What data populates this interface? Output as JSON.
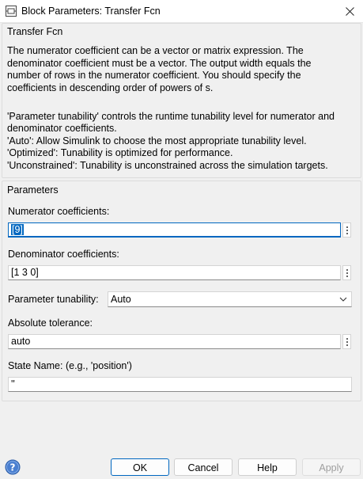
{
  "window": {
    "title": "Block Parameters: Transfer Fcn",
    "app_icon": "simulink-block-icon",
    "close_icon": "close-icon"
  },
  "block_section": {
    "label": "Transfer Fcn",
    "description": [
      "The numerator coefficient can be a vector or matrix expression. The",
      "denominator coefficient must be a vector. The output width equals the",
      "number of rows in the numerator coefficient. You should specify the",
      "coefficients in descending order of powers of s.",
      "",
      "'Parameter tunability' controls the runtime tunability level for numerator and",
      "denominator coefficients.",
      "'Auto': Allow Simulink to choose the most appropriate tunability level.",
      "'Optimized': Tunability is optimized for performance.",
      "'Unconstrained': Tunability is unconstrained across the simulation targets."
    ]
  },
  "parameters": {
    "label": "Parameters",
    "numerator_label": "Numerator coefficients:",
    "numerator_value": "[9]",
    "denominator_label": "Denominator coefficients:",
    "denominator_value": "[1 3 0]",
    "tunability_label": "Parameter tunability:",
    "tunability_value": "Auto",
    "abs_tol_label": "Absolute tolerance:",
    "abs_tol_value": "auto",
    "state_name_label": "State Name: (e.g., 'position')",
    "state_name_value": "''"
  },
  "buttons": {
    "ok": "OK",
    "cancel": "Cancel",
    "help": "Help",
    "apply": "Apply"
  },
  "colors": {
    "accent": "#0067c0",
    "background": "#f0f0f0",
    "help_icon": "#4a7fd0"
  }
}
